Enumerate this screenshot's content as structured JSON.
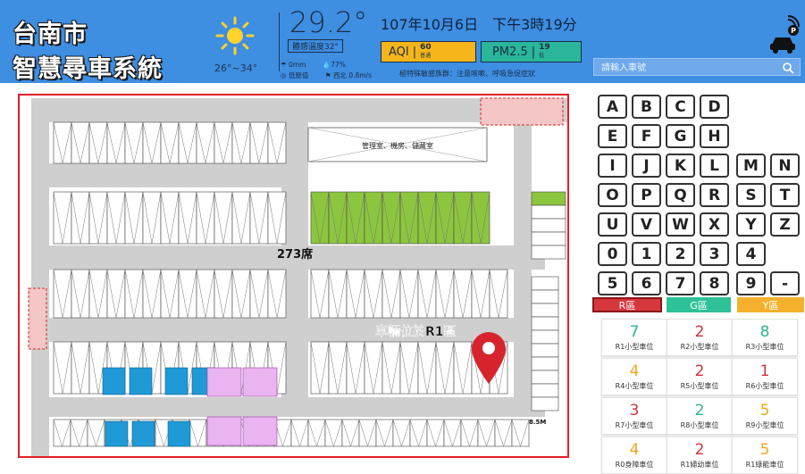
{
  "header": {
    "title_line1": "台南市",
    "title_line2": "智慧尋車系統",
    "temp_range": "26°~34°",
    "temperature": "29.2°",
    "feels_like": "體感溫度32°",
    "rain": "0mm",
    "humidity": "77%",
    "pressure": "低壓值",
    "wind": "西北 0.8m/s",
    "datetime": "107年10月6日　下午3時19分",
    "aqi_label": "AQI",
    "aqi_value": "60",
    "aqi_level": "普通",
    "pm_label": "PM2.5",
    "pm_value": "19",
    "pm_level": "低",
    "warning": "極特殊敏感族群：注意咳嗽、呼吸急促症狀",
    "search_placeholder": "請輸入車號",
    "colors": {
      "header_bg": "#3e8ee2",
      "aqi": "#f6b51b",
      "pm": "#29b69a"
    }
  },
  "map": {
    "office_label": "管理室、機房、儲藏室",
    "seat_count": "273席",
    "vehicle_location": "車輛位於R1區",
    "dimension": "8.5M"
  },
  "keypad": {
    "rows": [
      [
        "A",
        "B",
        "C",
        "D"
      ],
      [
        "E",
        "F",
        "G",
        "H"
      ],
      [
        "I",
        "J",
        "K",
        "L",
        "M",
        "N"
      ],
      [
        "O",
        "P",
        "Q",
        "R",
        "S",
        "T"
      ],
      [
        "U",
        "V",
        "W",
        "X",
        "Y",
        "Z"
      ],
      [
        "0",
        "1",
        "2",
        "3",
        "4"
      ],
      [
        "5",
        "6",
        "7",
        "8",
        "9",
        "-"
      ]
    ]
  },
  "zones": {
    "tabs": [
      {
        "label": "R區",
        "color": "#d6373d"
      },
      {
        "label": "G區",
        "color": "#2fc198"
      },
      {
        "label": "Y區",
        "color": "#f5b12d"
      }
    ],
    "slots": [
      {
        "count": "7",
        "label": "R1小型車位",
        "color": "#2fb392"
      },
      {
        "count": "2",
        "label": "R2小型車位",
        "color": "#d0313b"
      },
      {
        "count": "8",
        "label": "R3小型車位",
        "color": "#2fb392"
      },
      {
        "count": "4",
        "label": "R4小型車位",
        "color": "#eea720"
      },
      {
        "count": "2",
        "label": "R5小型車位",
        "color": "#d0313b"
      },
      {
        "count": "1",
        "label": "R6小型車位",
        "color": "#d0313b"
      },
      {
        "count": "3",
        "label": "R7小型車位",
        "color": "#d0313b"
      },
      {
        "count": "2",
        "label": "R8小型車位",
        "color": "#2fb392"
      },
      {
        "count": "5",
        "label": "R9小型車位",
        "color": "#eea720"
      },
      {
        "count": "4",
        "label": "R0身障車位",
        "color": "#eea720"
      },
      {
        "count": "2",
        "label": "R1婦幼車位",
        "color": "#d0313b"
      },
      {
        "count": "5",
        "label": "R1綠能車位",
        "color": "#eea720"
      }
    ]
  }
}
